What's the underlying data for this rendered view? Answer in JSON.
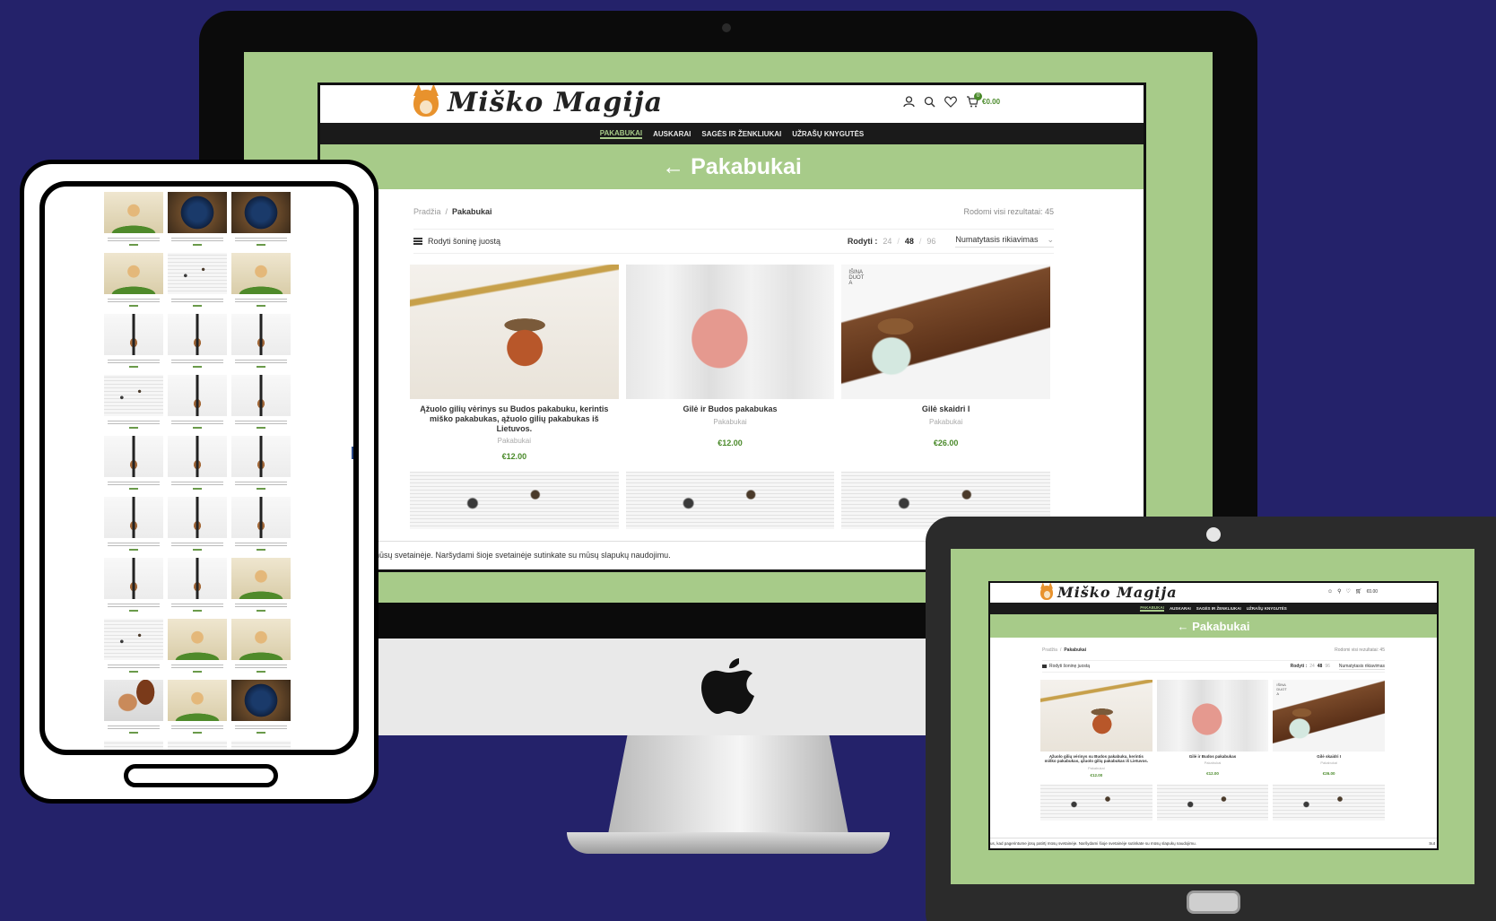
{
  "site": {
    "logo_text": "Miško Magija",
    "cart_amount": "€0.00",
    "cart_count": "0",
    "nav": [
      "PAKABUKAI",
      "AUSKARAI",
      "SAGĖS IR ŽENKLIUKAI",
      "UŽRAŠŲ KNYGUTĖS"
    ],
    "hero_title": "← Pakabukai",
    "breadcrumb_home": "Pradžia",
    "breadcrumb_sep": "/",
    "breadcrumb_current": "Pakabukai",
    "results_text": "Rodomi visi rezultatai: 45",
    "sidebar_toggle": "Rodyti šoninę juostą",
    "per_page_label": "Rodyti :",
    "per_page_options": [
      "24",
      "48",
      "96"
    ],
    "per_page_sep": "/",
    "sort_label": "Numatytasis rikiavimas",
    "cookie_text": "me jūsų patirtį mūsų svetainėje. Naršydami šioje svetainėje sutinkate su mūsų slapukų naudojimu.",
    "tablet_cookie_text": "us, kad pagerintume jūsų patirtį mūsų svetainėje. Naršydami šioje svetainėje sutinkate su mūsų slapukų naudojimu.",
    "tablet_cookie_button": "Sut",
    "new_badge": "IŠINA\nDUOT\nA",
    "products": [
      {
        "name": "Ąžuolo gilių vėrinys su Budos pakabuku, kerintis miško pakabukas, ąžuolo gilių pakabukas iš Lietuvos.",
        "category": "Pakabukai",
        "price": "€12.00"
      },
      {
        "name": "Gilė ir Budos pakabukas",
        "category": "Pakabukai",
        "price": "€12.00"
      },
      {
        "name": "Gilė skaidri I",
        "category": "Pakabukai",
        "price": "€26.00"
      }
    ]
  },
  "colors": {
    "background": "#24226a",
    "brand_green": "#a7cb89",
    "price_green": "#4a8a2a",
    "nav_bg": "#1a1a1a"
  },
  "icons": [
    "user-icon",
    "search-icon",
    "heart-icon",
    "cart-icon",
    "hamburger-icon",
    "apple-logo-icon"
  ]
}
